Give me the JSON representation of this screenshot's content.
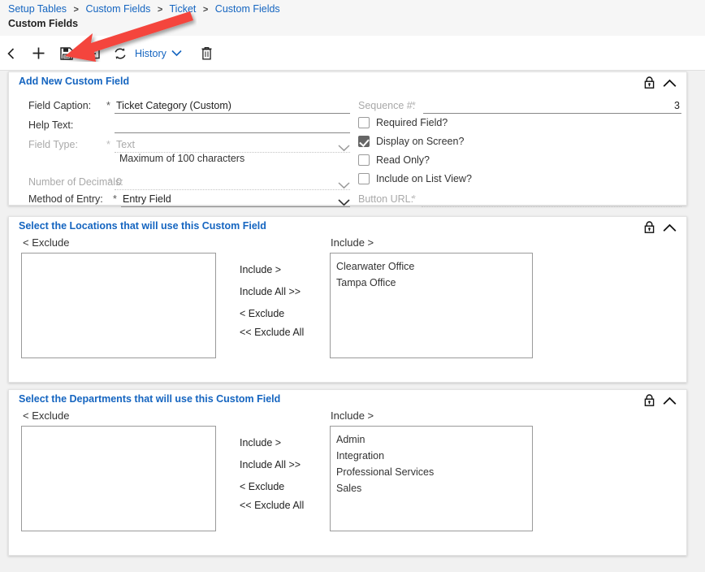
{
  "header": {
    "breadcrumb": [
      "Setup Tables",
      "Custom Fields",
      "Ticket",
      "Custom Fields"
    ],
    "separator": ">",
    "page_title": "Custom Fields"
  },
  "toolbar": {
    "back_label": "back-arrow",
    "add_label": "add",
    "save_label": "save",
    "save_exit_label": "save-and-exit",
    "refresh_label": "refresh",
    "history_label": "History",
    "delete_label": "delete"
  },
  "sections": {
    "custom_field": {
      "title": "Add New Custom Field",
      "fields": {
        "field_caption": {
          "label": "Field Caption:",
          "required": "*",
          "value": "Ticket Category (Custom)"
        },
        "help_text": {
          "label": "Help Text:",
          "required": "",
          "value": ""
        },
        "field_type": {
          "label": "Field Type:",
          "required": "*",
          "value": "Text"
        },
        "max_note": "Maximum of 100 characters",
        "number_of_decimals": {
          "label": "Number of Decimals:",
          "required": "*",
          "value": "0"
        },
        "method_of_entry": {
          "label": "Method of Entry:",
          "required": "*",
          "value": "Entry Field"
        },
        "sequence": {
          "label": "Sequence #:",
          "required": "*",
          "value": "3"
        },
        "button_url": {
          "label": "Button URL:",
          "required": "*",
          "value": ""
        }
      },
      "checkboxes": [
        {
          "label": "Required Field?",
          "checked": false
        },
        {
          "label": "Display on Screen?",
          "checked": true
        },
        {
          "label": "Read Only?",
          "checked": false
        },
        {
          "label": "Include on List View?",
          "checked": false
        }
      ]
    },
    "locations": {
      "title": "Select the Locations that will use this Custom Field",
      "exclude_header": "< Exclude",
      "include_header": "Include >",
      "exclude_items": [],
      "include_items": [
        "Clearwater Office",
        "Tampa Office"
      ],
      "buttons": [
        "Include >",
        "Include All >>",
        "< Exclude",
        "<< Exclude All"
      ]
    },
    "departments": {
      "title": "Select the Departments that will use this Custom Field",
      "exclude_header": "< Exclude",
      "include_header": "Include >",
      "exclude_items": [],
      "include_items": [
        "Admin",
        "Integration",
        "Professional Services",
        "Sales"
      ],
      "buttons": [
        "Include >",
        "Include All >>",
        "< Exclude",
        "<< Exclude All"
      ]
    }
  },
  "annotation": {
    "arrow_color": "#f4443c",
    "points_to": "save-button"
  },
  "colors": {
    "link": "#1565c0",
    "panel_title": "#1565c0",
    "text": "#333333",
    "disabled": "#a9a9a9"
  }
}
